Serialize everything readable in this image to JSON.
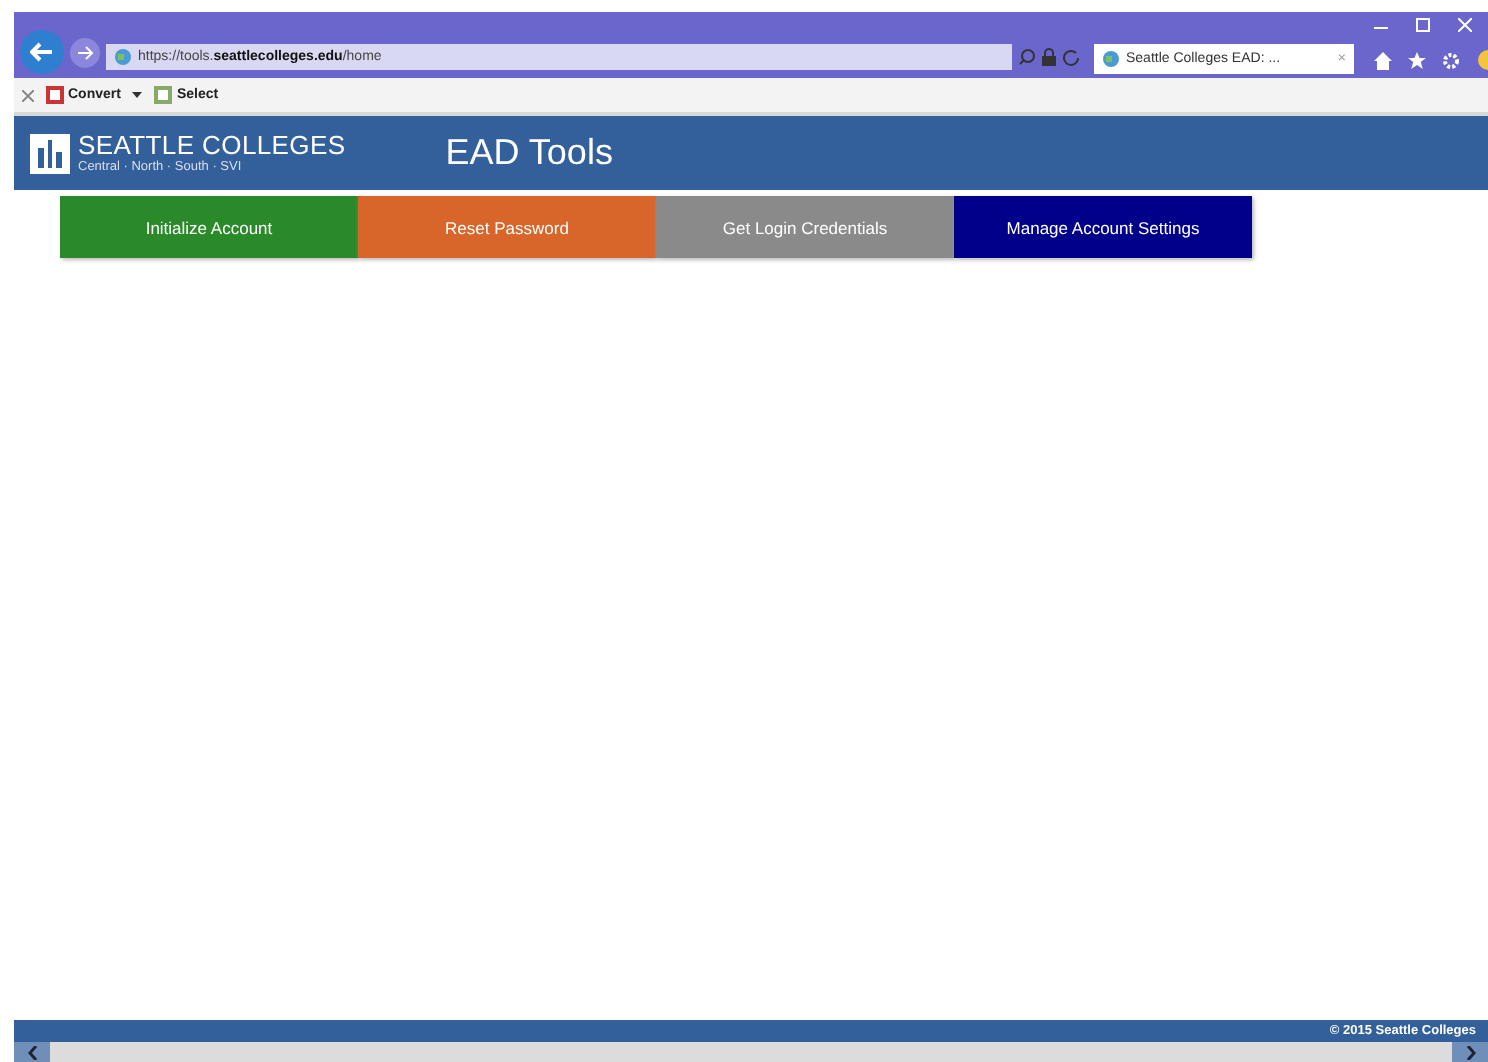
{
  "browser": {
    "address": "https://tools.**seattlecolleges.edu**/home",
    "tab": {
      "title": "Seattle Colleges EAD: ...",
      "close": "×",
      "selected": true
    },
    "toolbar": [
      {
        "label": "Convert",
        "kind": "dropdown"
      },
      {
        "label": "Select",
        "kind": "plain"
      }
    ]
  },
  "header": {
    "logo_title": "SEATTLE COLLEGES",
    "logo_subtitle": "Central · North · South · SVI",
    "app_title": "EAD Tools"
  },
  "nav": [
    {
      "label": "Initialize Account",
      "color": "#2a8a2a"
    },
    {
      "label": "Reset Password",
      "color": "#d8652a"
    },
    {
      "label": "Get Login Credentials",
      "color": "#8a8a8a"
    },
    {
      "label": "Manage Account Settings",
      "color": "#00008a"
    }
  ],
  "footer": {
    "copyright": "© 2015 Seattle Colleges"
  }
}
